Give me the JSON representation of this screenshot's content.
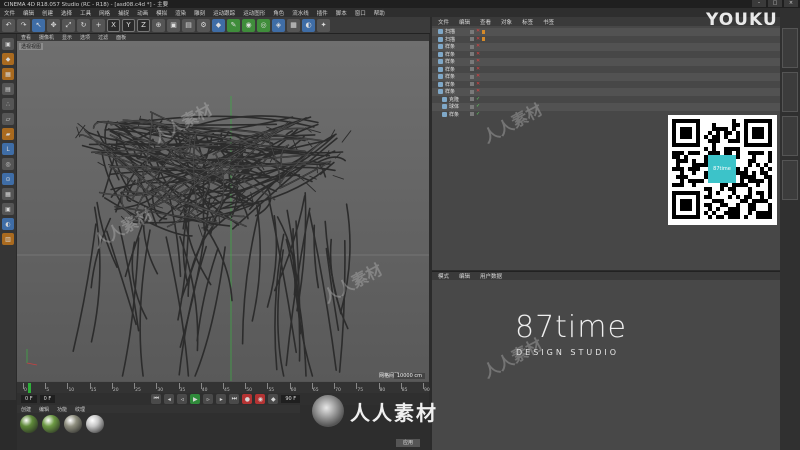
{
  "window": {
    "title": "CINEMA 4D R18.057 Studio (RC - R18) - [asd08.c4d *] - 主要"
  },
  "menubar": [
    "文件",
    "编辑",
    "创建",
    "选择",
    "工具",
    "网格",
    "捕捉",
    "动画",
    "模拟",
    "渲染",
    "雕刻",
    "运动跟踪",
    "运动图形",
    "角色",
    "流水线",
    "插件",
    "脚本",
    "窗口",
    "帮助"
  ],
  "viewport": {
    "menu": [
      "查看",
      "摄像机",
      "显示",
      "选项",
      "过滤",
      "面板"
    ],
    "label": "透视视图",
    "grid_label": "网格间距",
    "grid_value": "10000 cm"
  },
  "timeline": {
    "ticks": [
      "0",
      "5",
      "10",
      "15",
      "20",
      "25",
      "30",
      "35",
      "40",
      "45",
      "50",
      "55",
      "60",
      "65",
      "70",
      "75",
      "80",
      "85",
      "90"
    ],
    "start_frame": "0 F",
    "current_frame": "0 F",
    "end_frame": "90 F"
  },
  "material_manager": {
    "menu": [
      "创建",
      "编辑",
      "功能",
      "纹理"
    ],
    "materials": [
      {
        "color": "#5f8a3a"
      },
      {
        "color": "#6d9a44"
      },
      {
        "color": "#8f8f7f"
      },
      {
        "color": "#c7c7c7"
      }
    ]
  },
  "coordinates": {
    "apply_label": "应用"
  },
  "object_manager": {
    "menu": [
      "文件",
      "编辑",
      "查看",
      "对象",
      "标签",
      "书签"
    ],
    "objects": [
      {
        "name": "扫描",
        "x": true
      },
      {
        "name": "扫描",
        "x": true
      },
      {
        "name": "样条",
        "x": true
      },
      {
        "name": "样条",
        "x": true
      },
      {
        "name": "样条",
        "x": true
      },
      {
        "name": "样条",
        "x": true
      },
      {
        "name": "样条",
        "x": true
      },
      {
        "name": "样条",
        "x": true
      },
      {
        "name": "样条",
        "x": true
      },
      {
        "name": "克隆",
        "x": false
      },
      {
        "name": "球体",
        "x": false
      },
      {
        "name": "样条",
        "x": false
      }
    ]
  },
  "attributes": {
    "menu": [
      "模式",
      "编辑",
      "用户数据"
    ],
    "brand": "87time",
    "brand_sub": "DESIGN STUDIO"
  },
  "overlays": {
    "youku": "YOUKU",
    "watermark": "人人素材",
    "qr_center": "87time"
  },
  "colors": {
    "accent_orange": "#b9741c",
    "accent_blue": "#3f6da6",
    "active_green": "#2fae3a",
    "qr_teal": "#3cc3c9"
  }
}
